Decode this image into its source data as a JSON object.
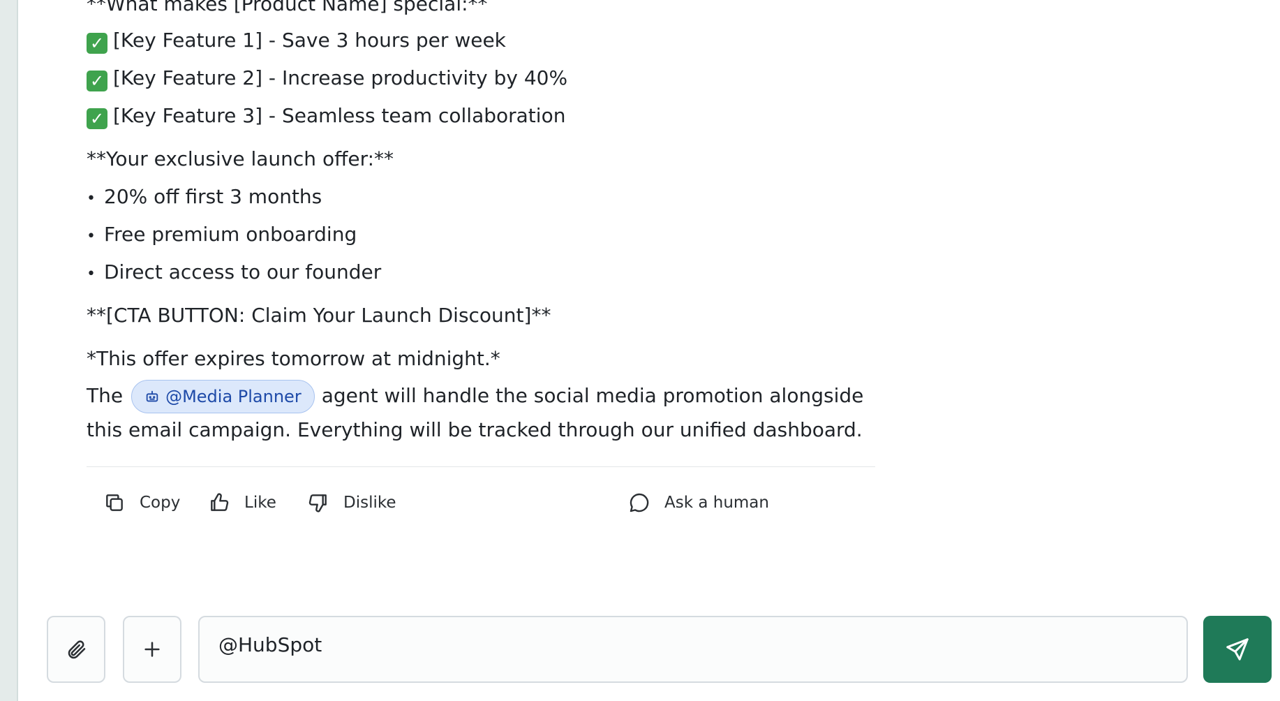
{
  "message": {
    "section_heading_partial": "**What makes [Product Name] special:**",
    "check_glyph": "✓",
    "features": [
      "[Key Feature 1] - Save 3 hours per week",
      "[Key Feature 2] - Increase productivity by 40%",
      "[Key Feature 3] - Seamless team collaboration"
    ],
    "offer_heading": "**Your exclusive launch offer:**",
    "bullet_glyph": "•",
    "offer_items": [
      "20% off first 3 months",
      "Free premium onboarding",
      "Direct access to our founder"
    ],
    "cta": "**[CTA BUTTON: Claim Your Launch Discount]**",
    "expiry_note": "*This offer expires tomorrow at midnight.*",
    "mention_prefix": "The",
    "mention_label": "@Media Planner",
    "mention_suffix": "agent will handle the social media promotion alongside this email campaign. Everything will be tracked through our unified dashboard."
  },
  "actions": {
    "copy": "Copy",
    "like": "Like",
    "dislike": "Dislike",
    "ask_human": "Ask a human"
  },
  "composer": {
    "input_value": "@HubSpot"
  },
  "colors": {
    "accent_send": "#1f7a58",
    "mention_bg": "#dce8fb",
    "mention_text": "#1e4aa8",
    "check_green": "#3fa34d"
  }
}
